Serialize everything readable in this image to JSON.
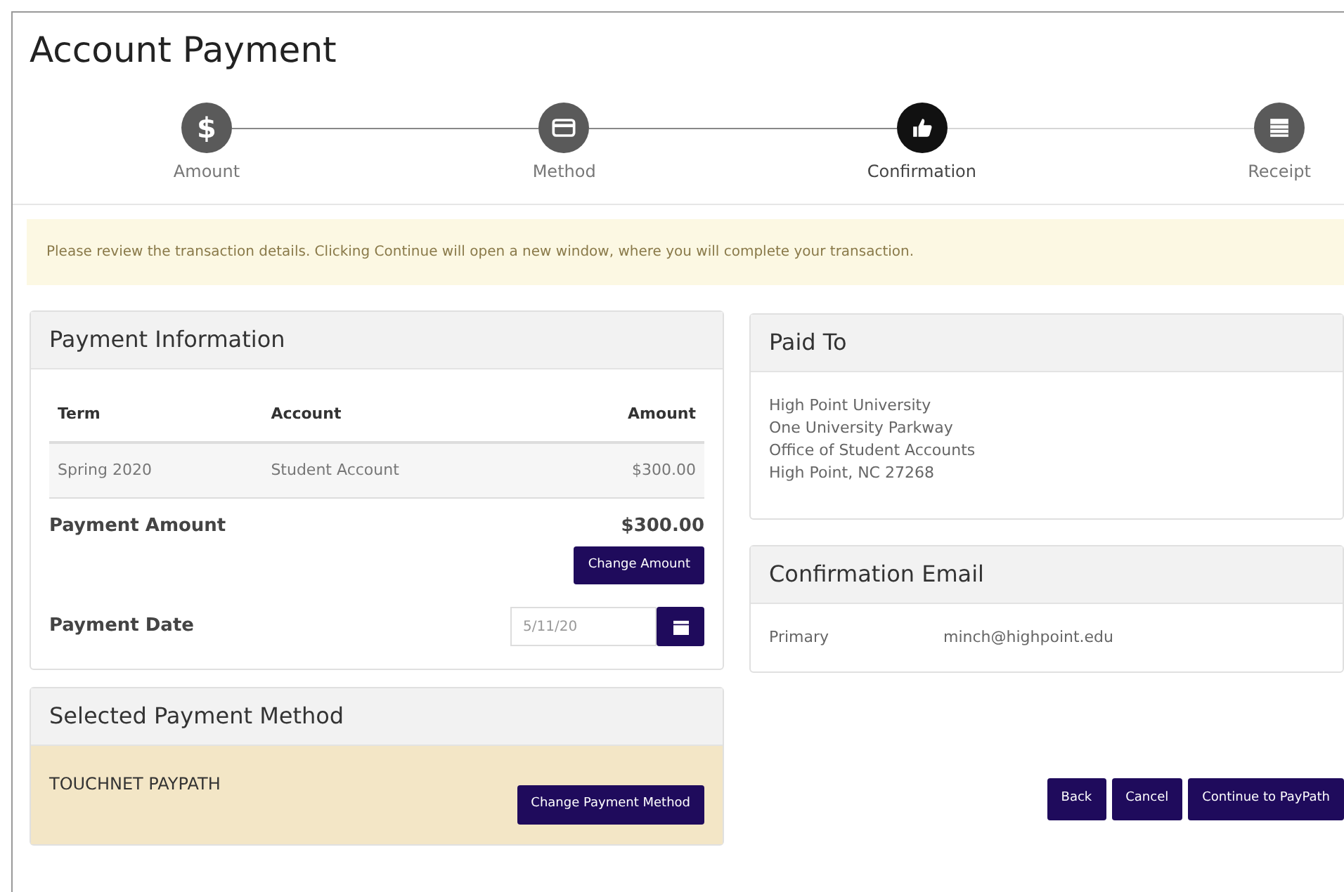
{
  "title": "Account Payment",
  "steps": [
    {
      "label": "Amount",
      "kind": "dollar",
      "symbol": "$",
      "selected": false
    },
    {
      "label": "Method",
      "kind": "card",
      "selected": false
    },
    {
      "label": "Confirmation",
      "kind": "thumb",
      "selected": true
    },
    {
      "label": "Receipt",
      "kind": "list",
      "selected": false
    }
  ],
  "notice": "Please review the transaction details. Clicking Continue will open a new window, where you will complete your transaction.",
  "payment_information": {
    "heading": "Payment Information",
    "columns": [
      "Term",
      "Account",
      "Amount"
    ],
    "rows": [
      [
        "Spring 2020",
        "Student Account",
        "$300.00"
      ]
    ],
    "amount_label": "Payment Amount",
    "amount": "$300.00",
    "change_amount": "Change Amount",
    "date_label": "Payment Date",
    "date": "5/11/20"
  },
  "selected_method": {
    "heading": "Selected Payment Method",
    "name": "TOUCHNET PAYPATH",
    "change": "Change Payment Method"
  },
  "paid_to": {
    "heading": "Paid To",
    "lines": [
      "High Point University",
      "One University Parkway",
      "Office of Student Accounts",
      "High Point, NC 27268"
    ]
  },
  "confirmation_email": {
    "heading": "Confirmation Email",
    "label": "Primary",
    "email": "minch@highpoint.edu"
  },
  "buttons": [
    "Back",
    "Cancel",
    "Continue to PayPath"
  ]
}
